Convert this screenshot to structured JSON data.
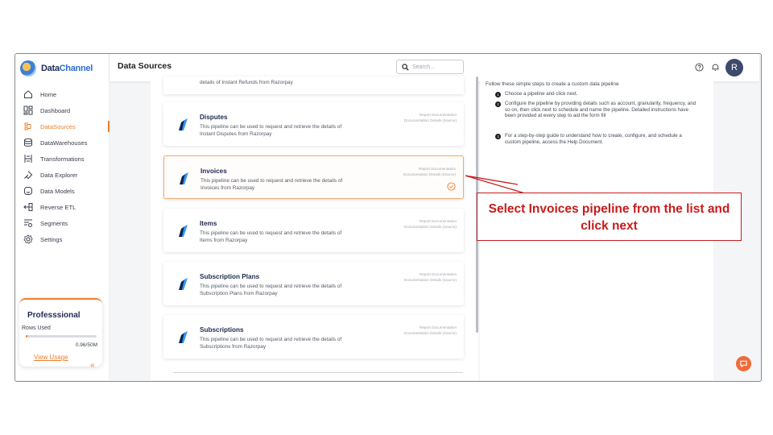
{
  "app": {
    "logo_text_a": "Data",
    "logo_text_b": "Channel"
  },
  "header": {
    "title": "Data Sources",
    "search_placeholder": "Search...",
    "avatar_initial": "R"
  },
  "sidebar": {
    "items": [
      {
        "label": "Home",
        "icon": "home-icon"
      },
      {
        "label": "Dashboard",
        "icon": "dashboard-icon"
      },
      {
        "label": "DataSources",
        "icon": "datasources-icon",
        "active": true
      },
      {
        "label": "DataWarehouses",
        "icon": "database-icon"
      },
      {
        "label": "Transformations",
        "icon": "transform-icon"
      },
      {
        "label": "Data Explorer",
        "icon": "explorer-icon"
      },
      {
        "label": "Data Models",
        "icon": "models-icon"
      },
      {
        "label": "Reverse ETL",
        "icon": "reverse-etl-icon"
      },
      {
        "label": "Segments",
        "icon": "segments-icon"
      },
      {
        "label": "Settings",
        "icon": "gear-icon"
      }
    ],
    "plan": {
      "title": "Professsional",
      "rows_label": "Rows Used",
      "rows_value": "0.96/50M",
      "rows_fraction": 0.02,
      "view_usage": "View Usage"
    }
  },
  "pipelines": {
    "partial_top_desc": "details of Instant Refunds from Razorpay",
    "link_report": "Report Documentation",
    "link_details": "Documentation Details (Source)",
    "cards": [
      {
        "title": "Disputes",
        "desc": "This pipeline can be used to request and retrieve the details of Instant Disputes from Razorpay",
        "selected": false
      },
      {
        "title": "Invoices",
        "desc": "This pipeline can be used to request and retrieve the details of Invoices from Razorpay",
        "selected": true
      },
      {
        "title": "Items",
        "desc": "This pipeline can be used to request and retrieve the details of Items from Razorpay",
        "selected": false
      },
      {
        "title": "Subscription Plans",
        "desc": "This pipeline can be used to request and retrieve the details of Subscription Plans from Razorpay",
        "selected": false
      },
      {
        "title": "Subscriptions",
        "desc": "This pipeline can be used to request and retrieve the details of Subscriptions from Razorpay",
        "selected": false
      }
    ]
  },
  "help": {
    "intro": "Follow these simple steps to create a custom data pipeline",
    "steps": [
      {
        "num": "1",
        "text": "Choose a pipeline and click next."
      },
      {
        "num": "2",
        "text": "Configure the pipeline by providing details such as account, granularity, frequency, and so on, then click next to schedule and name the pipeline. Detailed instructions have been provided at every step to aid the form fill"
      },
      {
        "num": "3",
        "text": "For a step-by-step guide to understand how to create, configure, and schedule a custom pipeline, access the Help Document."
      }
    ]
  },
  "callout": {
    "text": "Select Invoices pipeline from the list and click next",
    "color": "#c71b1b"
  },
  "colors": {
    "accent": "#ef7d2a",
    "navy": "#1e2a52"
  }
}
